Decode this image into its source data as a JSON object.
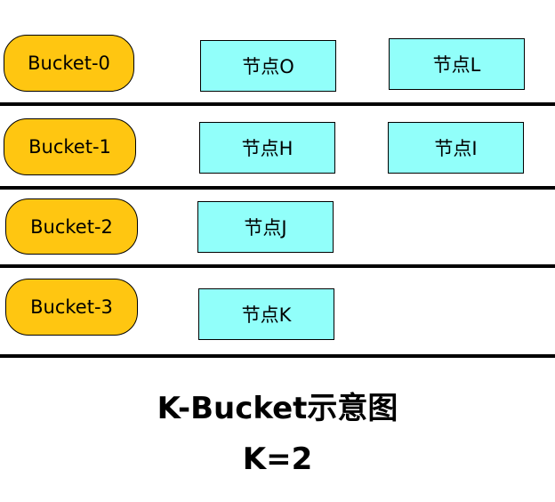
{
  "colors": {
    "bucket_fill": "#FFC611",
    "node_fill": "#91FFFA",
    "divider": "#000000"
  },
  "rows": [
    {
      "bucket": "Bucket-0",
      "nodes": [
        "节点O",
        "节点L"
      ]
    },
    {
      "bucket": "Bucket-1",
      "nodes": [
        "节点H",
        "节点I"
      ]
    },
    {
      "bucket": "Bucket-2",
      "nodes": [
        "节点J"
      ]
    },
    {
      "bucket": "Bucket-3",
      "nodes": [
        "节点K"
      ]
    }
  ],
  "caption": {
    "title": "K-Bucket示意图",
    "k_value": "K=2"
  }
}
